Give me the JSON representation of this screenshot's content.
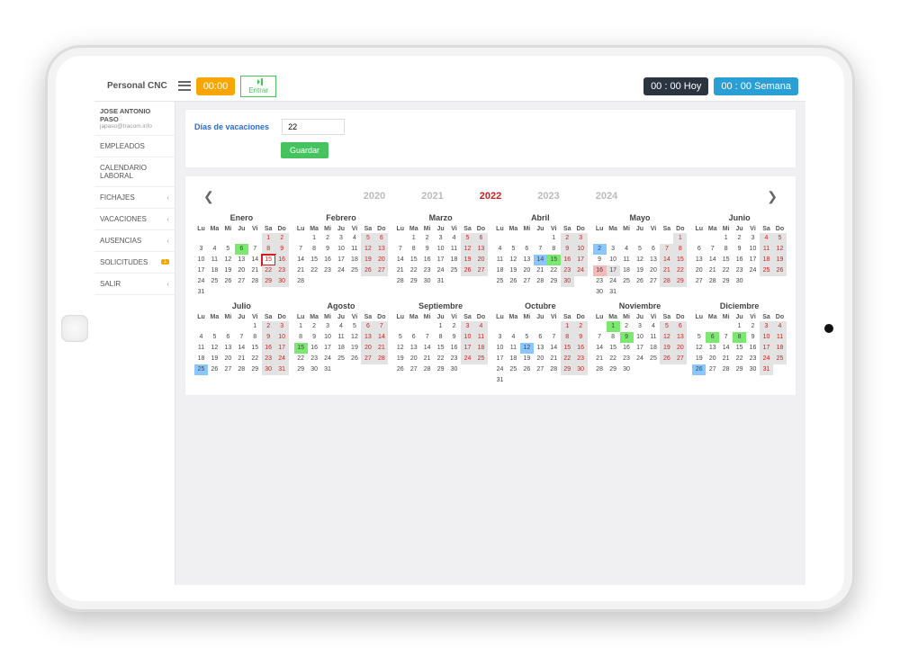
{
  "app": {
    "brand": "Personal CNC"
  },
  "topbar": {
    "clock": "00:00",
    "entrar": "Entrar",
    "hoy": "00 : 00 Hoy",
    "semana": "00 : 00 Semana"
  },
  "sidebar": {
    "user_name": "JOSE ANTONIO PASO",
    "user_email": "japaso@tracom.info",
    "items": [
      {
        "label": "EMPLEADOS",
        "expandable": false
      },
      {
        "label": "CALENDARIO LABORAL",
        "expandable": false
      },
      {
        "label": "FICHAJES",
        "expandable": true
      },
      {
        "label": "VACACIONES",
        "expandable": true
      },
      {
        "label": "AUSENCIAS",
        "expandable": true
      },
      {
        "label": "SOLICITUDES",
        "badge": "1"
      },
      {
        "label": "SALIR",
        "expandable": true
      }
    ]
  },
  "form": {
    "label": "Días de vacaciones",
    "value": "22",
    "save": "Guardar"
  },
  "yearnav": {
    "years": [
      "2020",
      "2021",
      "2022",
      "2023",
      "2024"
    ],
    "current": "2022"
  },
  "dow": [
    "Lu",
    "Ma",
    "Mi",
    "Ju",
    "Vi",
    "Sa",
    "Do"
  ],
  "months": [
    {
      "name": "Enero",
      "start": 5,
      "days": 31,
      "hl": {
        "1": "grey",
        "2": "grey",
        "6": "green",
        "8": "grey",
        "9": "grey",
        "15": "red-border",
        "16": "grey",
        "22": "grey",
        "23": "grey",
        "29": "grey",
        "30": "grey"
      }
    },
    {
      "name": "Febrero",
      "start": 1,
      "days": 28,
      "hl": {
        "5": "grey",
        "6": "grey",
        "12": "grey",
        "13": "grey",
        "19": "grey",
        "20": "grey",
        "26": "grey",
        "27": "grey"
      }
    },
    {
      "name": "Marzo",
      "start": 1,
      "days": 31,
      "hl": {
        "5": "grey",
        "6": "grey",
        "12": "grey",
        "13": "grey",
        "19": "grey",
        "20": "grey",
        "26": "grey",
        "27": "grey"
      }
    },
    {
      "name": "Abril",
      "start": 4,
      "days": 30,
      "hl": {
        "2": "grey",
        "3": "grey",
        "9": "grey",
        "10": "grey",
        "14": "blue",
        "15": "green",
        "16": "grey",
        "17": "grey",
        "23": "grey",
        "24": "grey",
        "30": "grey"
      }
    },
    {
      "name": "Mayo",
      "start": 6,
      "days": 31,
      "hl": {
        "1": "grey",
        "2": "blue",
        "7": "grey",
        "8": "grey",
        "14": "grey",
        "15": "grey",
        "16": "pink",
        "17": "grey",
        "21": "grey",
        "22": "grey",
        "28": "grey",
        "29": "grey"
      }
    },
    {
      "name": "Junio",
      "start": 2,
      "days": 30,
      "hl": {
        "4": "grey",
        "5": "grey",
        "11": "grey",
        "12": "grey",
        "18": "grey",
        "19": "grey",
        "25": "grey",
        "26": "grey"
      }
    },
    {
      "name": "Julio",
      "start": 4,
      "days": 31,
      "hl": {
        "2": "grey",
        "3": "grey",
        "9": "grey",
        "10": "grey",
        "16": "grey",
        "17": "grey",
        "23": "grey",
        "24": "grey",
        "25": "blue",
        "30": "grey",
        "31": "grey"
      }
    },
    {
      "name": "Agosto",
      "start": 0,
      "days": 31,
      "hl": {
        "6": "grey",
        "7": "grey",
        "13": "grey",
        "14": "grey",
        "15": "green",
        "20": "grey",
        "21": "grey",
        "27": "grey",
        "28": "grey"
      }
    },
    {
      "name": "Septiembre",
      "start": 3,
      "days": 30,
      "hl": {
        "3": "grey",
        "4": "grey",
        "10": "grey",
        "11": "grey",
        "17": "grey",
        "18": "grey",
        "24": "grey",
        "25": "grey"
      }
    },
    {
      "name": "Octubre",
      "start": 5,
      "days": 31,
      "hl": {
        "1": "grey",
        "2": "grey",
        "8": "grey",
        "9": "grey",
        "12": "blue",
        "15": "grey",
        "16": "grey",
        "22": "grey",
        "23": "grey",
        "29": "grey",
        "30": "grey"
      }
    },
    {
      "name": "Noviembre",
      "start": 1,
      "days": 30,
      "hl": {
        "1": "green",
        "5": "grey",
        "6": "grey",
        "9": "green",
        "12": "grey",
        "13": "grey",
        "19": "grey",
        "20": "grey",
        "26": "grey",
        "27": "grey"
      }
    },
    {
      "name": "Diciembre",
      "start": 3,
      "days": 31,
      "hl": {
        "3": "grey",
        "4": "grey",
        "6": "green",
        "8": "green",
        "10": "grey",
        "11": "grey",
        "17": "grey",
        "18": "grey",
        "24": "grey",
        "25": "grey",
        "26": "blue",
        "31": "grey"
      }
    }
  ]
}
